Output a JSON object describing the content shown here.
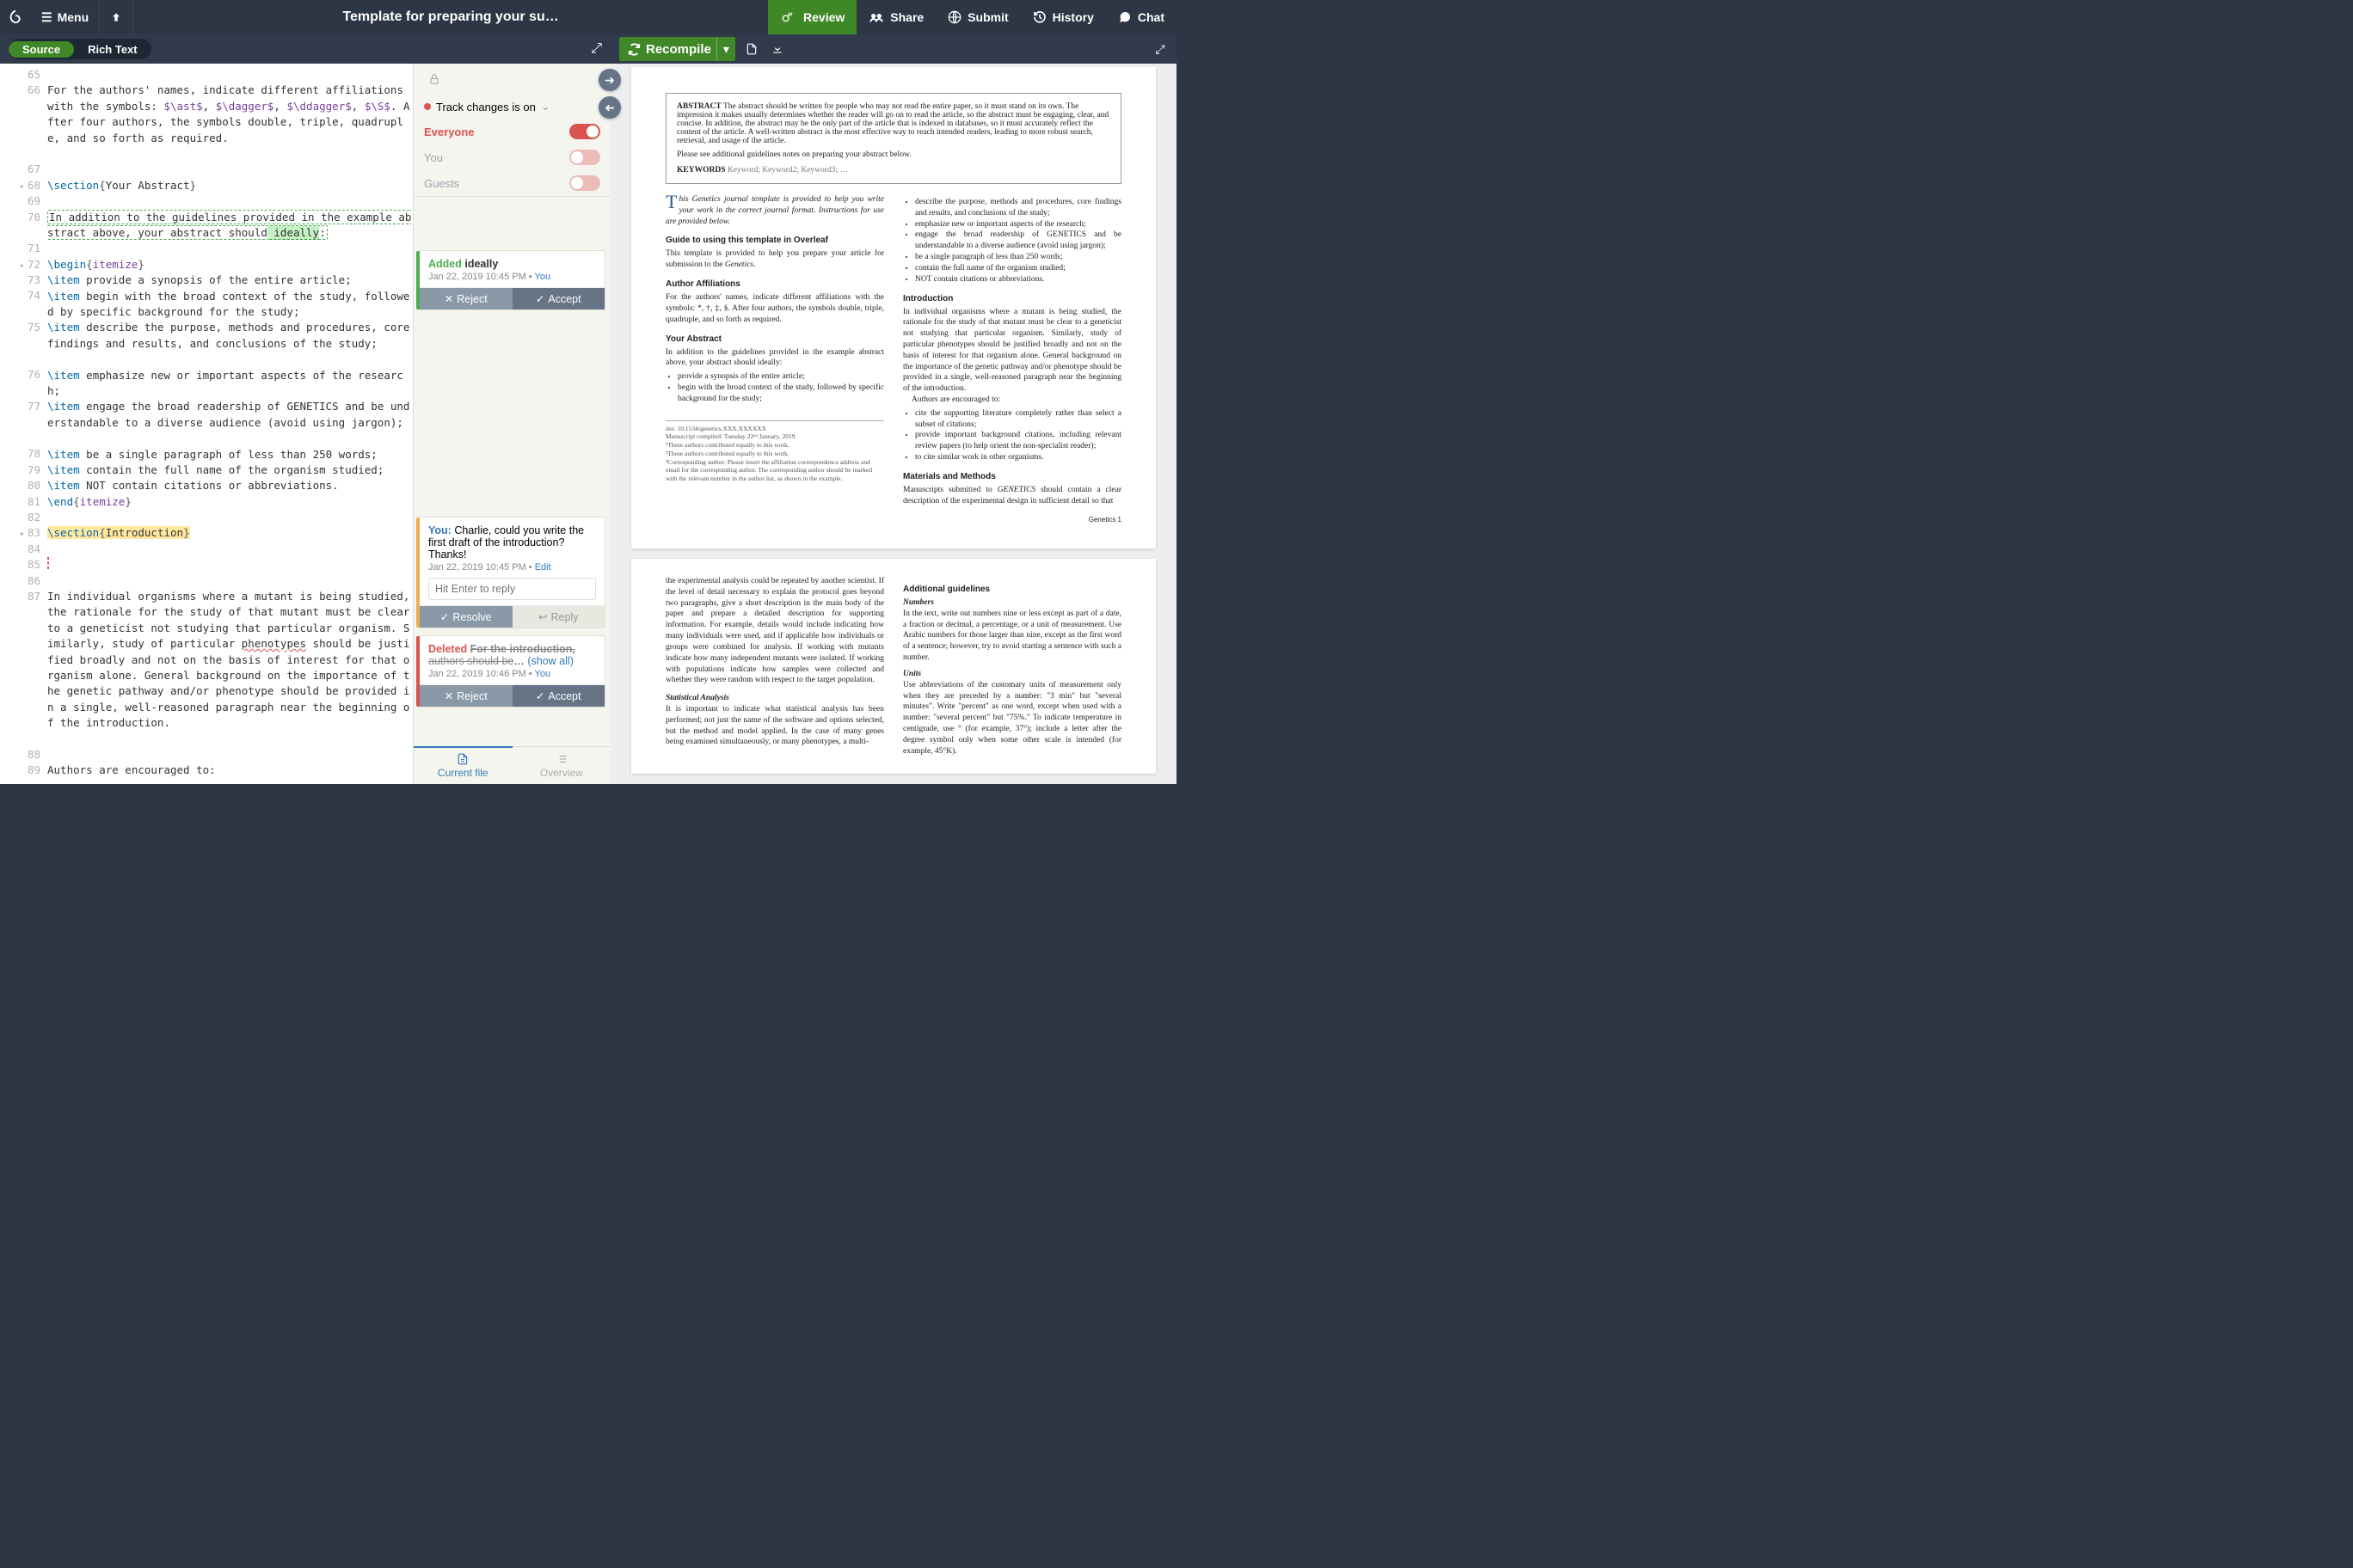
{
  "header": {
    "menu": "Menu",
    "title": "Template for preparing your su…",
    "review": "Review",
    "share": "Share",
    "submit": "Submit",
    "history": "History",
    "chat": "Chat"
  },
  "editorTabs": {
    "source": "Source",
    "rich": "Rich Text"
  },
  "recompile": "Recompile",
  "reviewTop": {
    "track": "Track changes is on",
    "everyone": "Everyone",
    "you": "You",
    "guests": "Guests"
  },
  "cards": {
    "added": {
      "title": "Added",
      "word": "ideally",
      "meta": "Jan 22, 2019 10:45 PM",
      "by": "You",
      "reject": "Reject",
      "accept": "Accept"
    },
    "comment": {
      "author": "You:",
      "text": "Charlie, could you write the first draft of the introduction? Thanks!",
      "meta": "Jan 22, 2019 10:45 PM",
      "edit": "Edit",
      "placeholder": "Hit Enter to reply",
      "resolve": "Resolve",
      "reply": "Reply"
    },
    "deleted": {
      "title": "Deleted",
      "struck": "For the introduction,",
      "line2a": "authors should be",
      "line2b": "…",
      "showall": "(show all)",
      "meta": "Jan 22, 2019 10:46 PM",
      "by": "You",
      "reject": "Reject",
      "accept": "Accept"
    }
  },
  "footerTabs": {
    "current": "Current file",
    "overview": "Overview"
  },
  "lines": [
    {
      "n": "65",
      "h": 1
    },
    {
      "n": "66",
      "h": 5,
      "html": "For the authors' names, indicate different affiliations with the symbols: <span class='tex-math'>$\\ast$</span>, <span class='tex-math'>$\\dagger$</span>, <span class='tex-math'>$\\ddagger$</span>, <span class='tex-math'>$\\S$</span>. After four authors, the symbols double, triple, quadruple, and so forth as required."
    },
    {
      "n": "67",
      "h": 1
    },
    {
      "n": "68",
      "h": 1,
      "fold": true,
      "html": "<span class='tex-cmd'>\\section</span><span class='tex-brace'>{</span>Your Abstract<span class='tex-brace'>}</span>"
    },
    {
      "n": "69",
      "h": 1
    },
    {
      "n": "70",
      "h": 2,
      "html": "<span class='dotted-green' style='padding:0 1px;'>In addition to the guidelines provided in the example abstract above, your abstract should<span class='ins-green'> ideally</span>:</span>"
    },
    {
      "n": "71",
      "h": 1
    },
    {
      "n": "72",
      "h": 1,
      "fold": true,
      "html": "<span class='tex-cmd'>\\begin</span><span class='tex-brace'>{</span><span class='tex-group'>itemize</span><span class='tex-brace'>}</span>"
    },
    {
      "n": "73",
      "h": 1,
      "html": "<span class='tex-cmd'>\\item</span> provide a synopsis of the entire article;"
    },
    {
      "n": "74",
      "h": 2,
      "html": "<span class='tex-cmd'>\\item</span> begin with the broad context of the study, followed by specific background for the study;"
    },
    {
      "n": "75",
      "h": 3,
      "html": "<span class='tex-cmd'>\\item</span> describe the purpose, methods and procedures, core findings and results, and conclusions of the study;"
    },
    {
      "n": "76",
      "h": 2,
      "html": "<span class='tex-cmd'>\\item</span> emphasize new or important aspects of the research;"
    },
    {
      "n": "77",
      "h": 3,
      "html": "<span class='tex-cmd'>\\item</span> engage the broad readership of GENETICS and be understandable to a diverse audience (avoid using jargon);"
    },
    {
      "n": "78",
      "h": 1,
      "html": "<span class='tex-cmd'>\\item</span> be a single paragraph of less than 250 words;"
    },
    {
      "n": "79",
      "h": 1,
      "html": "<span class='tex-cmd'>\\item</span> contain the full name of the organism studied;"
    },
    {
      "n": "80",
      "h": 1,
      "html": "<span class='tex-cmd'>\\item</span> NOT contain citations or abbreviations."
    },
    {
      "n": "81",
      "h": 1,
      "html": "<span class='tex-cmd'>\\end</span><span class='tex-brace'>{</span><span class='tex-group'>itemize</span><span class='tex-brace'>}</span>"
    },
    {
      "n": "82",
      "h": 1
    },
    {
      "n": "83",
      "h": 1,
      "fold": true,
      "html": "<span class='hilite-yellow'><span class='tex-cmd'>\\section</span><span class='tex-brace'>{</span>Introduction<span class='tex-brace'>}</span></span>"
    },
    {
      "n": "84",
      "h": 1
    },
    {
      "n": "85",
      "h": 1,
      "html": "<span style='border:1px dashed #d9534f; display:inline-block; width:2px; height:14px;'></span>"
    },
    {
      "n": "86",
      "h": 1
    },
    {
      "n": "87",
      "h": 10,
      "html": "In individual organisms where a mutant is being studied, the rationale for the study of that mutant must be clear to a geneticist not studying that particular organism. Similarly, study of particular <span class='wavy-red'>phenotypes</span> should be justified broadly and not on the basis of interest for that organism alone. General background on the importance of the genetic pathway and/or phenotype should be provided in a single, well-reasoned paragraph near the beginning of the introduction."
    },
    {
      "n": "88",
      "h": 1
    },
    {
      "n": "89",
      "h": 1,
      "html": "Authors are encouraged to:"
    }
  ],
  "pdf": {
    "abstractLabel": "ABSTRACT",
    "abstractText": "The abstract should be written for people who may not read the entire paper, so it must stand on its own. The impression it makes usually determines whether the reader will go on to read the article, so the abstract must be engaging, clear, and concise. In addition, the abstract may be the only part of the article that is indexed in databases, so it must accurately reflect the content of the article. A well-written abstract is the most effective way to reach intended readers, leading to more robust search, retrieval, and usage of the article.",
    "abstractNote": "Please see additional guidelines notes on preparing your abstract below.",
    "keywordsLabel": "KEYWORDS",
    "keywords": "Keyword; Keyword2; Keyword3; …",
    "intro1": "his Genetics journal template is provided to help you write your work in the correct journal format. Instructions for use are provided below.",
    "guideHead": "Guide to using this template in Overleaf",
    "guideText": "This template is provided to help you prepare your article for submission to the Genetics.",
    "affHead": "Author Affiliations",
    "affText": "For the authors' names, indicate different affiliations with the symbols: *, †, ‡, §. After four authors, the symbols double, triple, quadruple, and so forth as required.",
    "yourAbsHead": "Your Abstract",
    "yourAbsText": "In addition to the guidelines provided in the example abstract above, your abstract should ideally:",
    "absList": [
      "provide a synopsis of the entire article;",
      "begin with the broad context of the study, followed by specific background for the study;"
    ],
    "rightList": [
      "describe the purpose, methods and procedures, core findings and results, and conclusions of the study;",
      "emphasize new or important aspects of the research;",
      "engage the broad readership of GENETICS and be understandable to a diverse audience (avoid using jargon);",
      "be a single paragraph of less than 250 words;",
      "contain the full name of the organism studied;",
      "NOT contain citations or abbreviations."
    ],
    "introHead": "Introduction",
    "introText": "In individual organisms where a mutant is being studied, the rationale for the study of that mutant must be clear to a geneticist not studying that particular organism. Similarly, study of particular phenotypes should be justified broadly and not on the basis of interest for that organism alone. General background on the importance of the genetic pathway and/or phenotype should be provided in a single, well-reasoned paragraph near the beginning of the introduction.",
    "introNote": "Authors are encouraged to:",
    "introList": [
      "cite the supporting literature completely rather than select a subset of citations;",
      "provide important background citations, including relevant review papers (to help orient the non-specialist reader);",
      "to cite similar work in other organisms."
    ],
    "mmHead": "Materials and Methods",
    "mmText": "Manuscripts submitted to GENETICS should contain a clear description of the experimental design in sufficient detail so that",
    "foot": [
      "doi: 10.1534/genetics.XXX.XXXXXX",
      "Manuscript compiled: Tuesday 22ⁿᵈ January, 2019",
      "¹These authors contributed equally to this work.",
      "²These authors contributed equally to this work.",
      "³Corresponding author: Please insert the affiliation correspondence address and email for the corresponding author. The corresponding author should be marked with the relevant number in the author list, as shown in the example."
    ],
    "pagelabel": "Genetics    1",
    "p2_col1a": "the experimental analysis could be repeated by another scientist. If the level of detail necessary to explain the protocol goes beyond two paragraphs, give a short description in the main body of the paper and prepare a detailed description for supporting information. For example, details would include indicating how many individuals were used, and if applicable how individuals or groups were combined for analysis. If working with mutants indicate how many independent mutants were isolated. If working with populations indicate how samples were collected and whether they were random with respect to the target population.",
    "p2_statHead": "Statistical Analysis",
    "p2_statText": "It is important to indicate what statistical analysis has been performed; not just the name of the software and options selected, but the method and model applied. In the case of many genes being examined simultaneously, or many phenotypes, a multi-",
    "p2_addHead": "Additional guidelines",
    "p2_numHead": "Numbers",
    "p2_numText": "In the text, write out numbers nine or less except as part of a date, a fraction or decimal, a percentage, or a unit of measurement. Use Arabic numbers for those larger than nine, except as the first word of a sentence; however, try to avoid starting a sentence with such a number.",
    "p2_unitsHead": "Units",
    "p2_unitsText": "Use abbreviations of the customary units of measurement only when they are preceded by a number: \"3 min\" but \"several minutes\". Write \"percent\" as one word, except when used with a number: \"several percent\" but \"75%.\" To indicate temperature in centigrade, use ° (for example, 37°); include a letter after the degree symbol only when some other scale is intended (for example, 45°K)."
  }
}
